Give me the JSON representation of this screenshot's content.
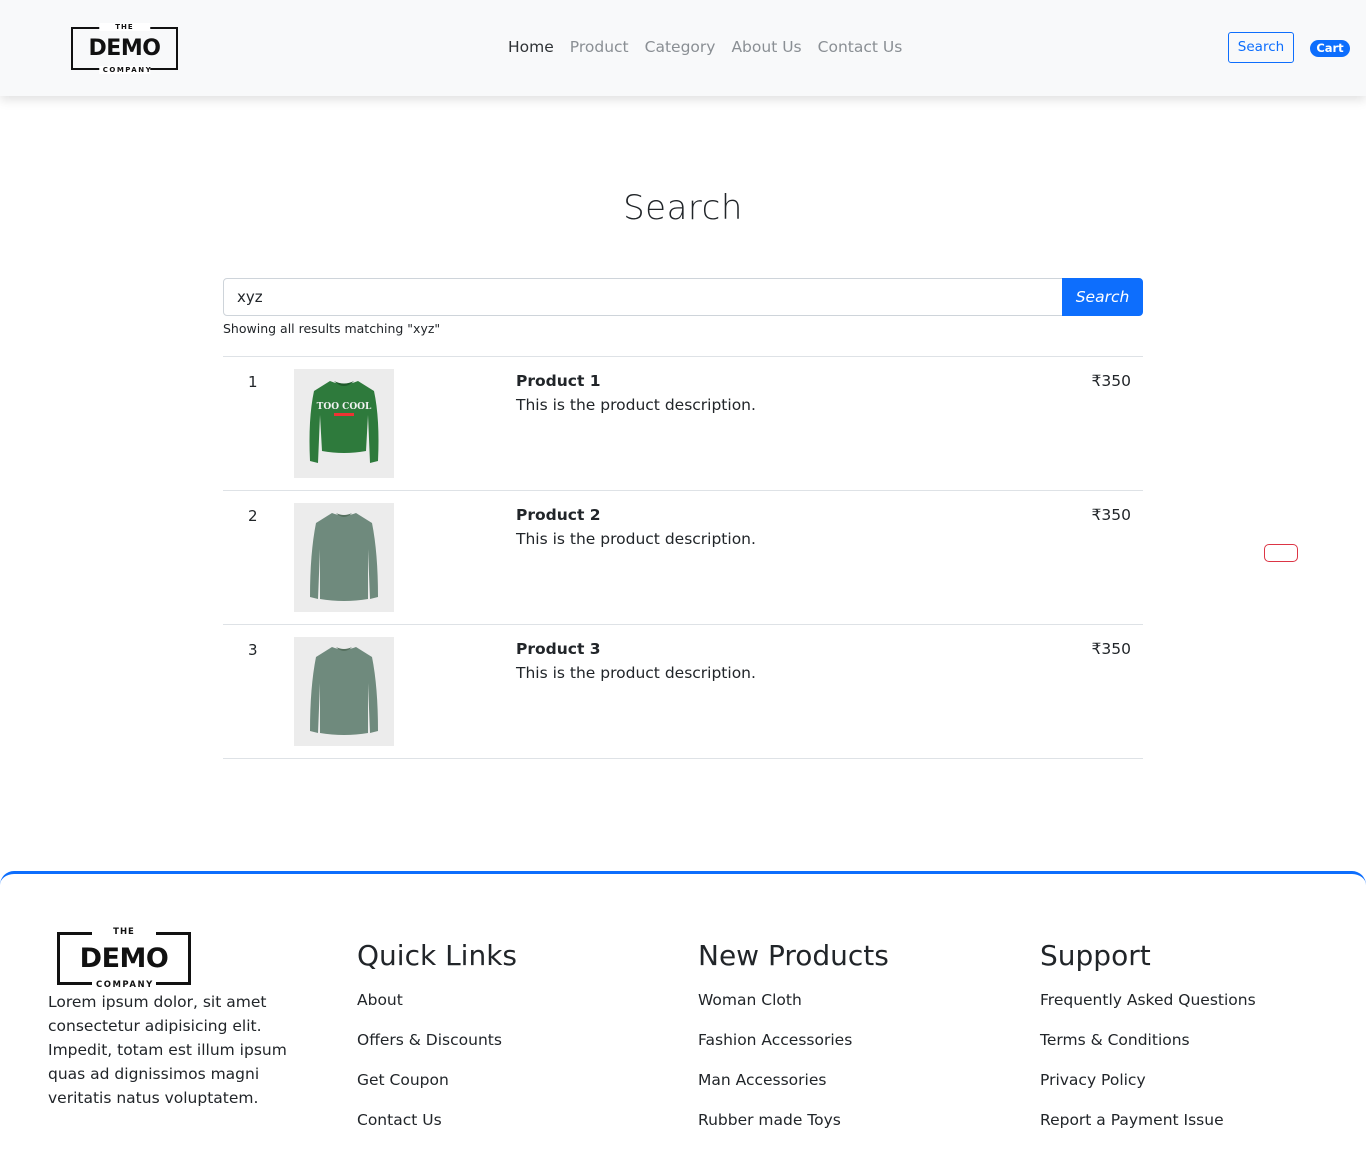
{
  "header": {
    "logo": {
      "top": "THE",
      "main": "DEMO",
      "bottom": "COMPANY"
    },
    "nav": [
      {
        "label": "Home",
        "active": true
      },
      {
        "label": "Product",
        "active": false
      },
      {
        "label": "Category",
        "active": false
      },
      {
        "label": "About Us",
        "active": false
      },
      {
        "label": "Contact Us",
        "active": false
      }
    ],
    "search_button": "Search",
    "cart_button": "Cart"
  },
  "main": {
    "title": "Search",
    "search": {
      "value": "xyz",
      "button": "Search"
    },
    "results_note": "Showing all results matching \"xyz\"",
    "results": [
      {
        "index": "1",
        "name": "Product 1",
        "description": "This is the product description.",
        "price": "₹350",
        "image": "green-sweatshirt"
      },
      {
        "index": "2",
        "name": "Product 2",
        "description": "This is the product description.",
        "price": "₹350",
        "image": "grey-sweatshirt"
      },
      {
        "index": "3",
        "name": "Product 3",
        "description": "This is the product description.",
        "price": "₹350",
        "image": "grey-sweatshirt"
      }
    ]
  },
  "footer": {
    "logo": {
      "top": "THE",
      "main": "DEMO",
      "bottom": "COMPANY"
    },
    "about": "Lorem ipsum dolor, sit amet consectetur adipisicing elit. Impedit, totam est illum ipsum quas ad dignissimos magni veritatis natus voluptatem.",
    "quick_links": {
      "title": "Quick Links",
      "items": [
        "About",
        "Offers & Discounts",
        "Get Coupon",
        "Contact Us"
      ]
    },
    "new_products": {
      "title": "New Products",
      "items": [
        "Woman Cloth",
        "Fashion Accessories",
        "Man Accessories",
        "Rubber made Toys"
      ]
    },
    "support": {
      "title": "Support",
      "items": [
        "Frequently Asked Questions",
        "Terms & Conditions",
        "Privacy Policy",
        "Report a Payment Issue"
      ]
    }
  },
  "colors": {
    "primary": "#0d6efd",
    "danger": "#dc3545",
    "navbar_bg": "#f8f9fa"
  }
}
